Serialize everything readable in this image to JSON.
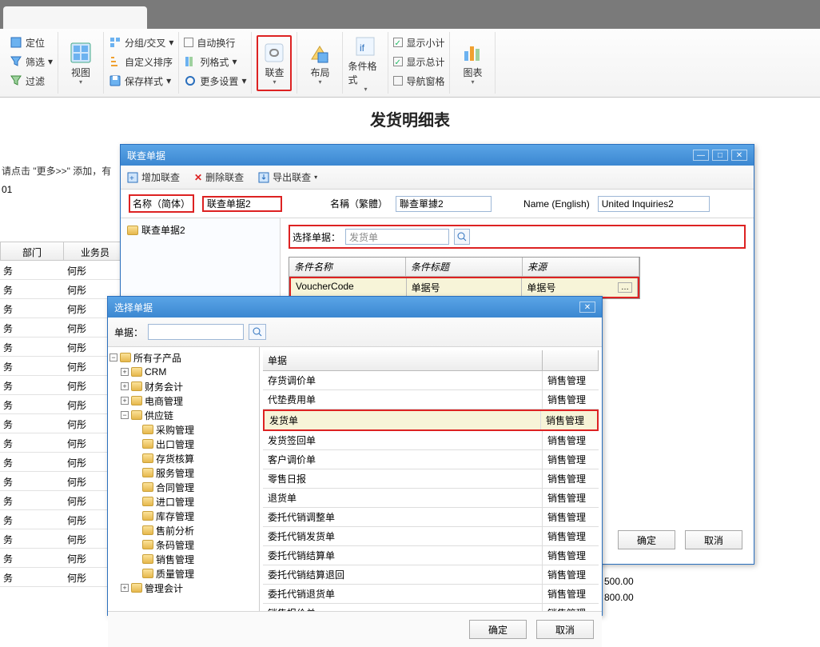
{
  "ribbon": {
    "locate": "定位",
    "filter": "筛选",
    "filter2": "过滤",
    "view": "视图",
    "group_cross": "分组/交叉",
    "custom_sort": "自定义排序",
    "save_style": "保存样式",
    "auto_wrap": "自动换行",
    "col_format": "列格式",
    "more_settings": "更多设置",
    "lianchap": "联查",
    "layout": "布局",
    "cond_format": "条件格式",
    "show_subtotal": "显示小计",
    "show_total": "显示总计",
    "nav_pane": "导航窗格",
    "chart": "图表"
  },
  "page_title": "发货明细表",
  "bg": {
    "hint": "请点击 \"更多>>\" 添加，有",
    "code": "01",
    "col1": "部门",
    "col2": "业务员",
    "v1": "务",
    "v2": "何彤"
  },
  "dialog1": {
    "title": "联查单据",
    "btn_add": "增加联查",
    "btn_del": "删除联查",
    "btn_export": "导出联查",
    "name_cn_lbl": "名称（简体）",
    "name_cn_val": "联查单据2",
    "name_tw_lbl": "名稱（繁體）",
    "name_tw_val": "聯查單據2",
    "name_en_lbl": "Name (English)",
    "name_en_val": "United Inquiries2",
    "tree_root": "联查单据2",
    "select_doc_lbl": "选择单据：",
    "select_doc_val": "发货单",
    "cond_h1": "条件名称",
    "cond_h2": "条件标题",
    "cond_h3": "来源",
    "cond_v1": "VoucherCode",
    "cond_v2": "单据号",
    "cond_v3": "单据号",
    "ok": "确定",
    "cancel": "取消"
  },
  "dialog2": {
    "title": "选择单据",
    "search_lbl": "单据：",
    "tree": {
      "root": "所有子产品",
      "n1": "CRM",
      "n2": "财务会计",
      "n3": "电商管理",
      "n4": "供应链",
      "s1": "采购管理",
      "s2": "出口管理",
      "s3": "存货核算",
      "s4": "服务管理",
      "s5": "合同管理",
      "s6": "进口管理",
      "s7": "库存管理",
      "s8": "售前分析",
      "s9": "条码管理",
      "s10": "销售管理",
      "s11": "质量管理",
      "n5": "管理会计"
    },
    "list_h1": "单据",
    "list_h2": "",
    "rows": [
      {
        "a": "存货调价单",
        "b": "销售管理"
      },
      {
        "a": "代垫费用单",
        "b": "销售管理"
      },
      {
        "a": "发货单",
        "b": "销售管理"
      },
      {
        "a": "发货签回单",
        "b": "销售管理"
      },
      {
        "a": "客户调价单",
        "b": "销售管理"
      },
      {
        "a": "零售日报",
        "b": "销售管理"
      },
      {
        "a": "退货单",
        "b": "销售管理"
      },
      {
        "a": "委托代销调整单",
        "b": "销售管理"
      },
      {
        "a": "委托代销发货单",
        "b": "销售管理"
      },
      {
        "a": "委托代销结算单",
        "b": "销售管理"
      },
      {
        "a": "委托代销结算退回",
        "b": "销售管理"
      },
      {
        "a": "委托代销退货单",
        "b": "销售管理"
      },
      {
        "a": "销售报价单",
        "b": "销售管理"
      }
    ],
    "ok": "确定",
    "cancel": "取消"
  },
  "amounts": {
    "a1": "500.00",
    "a2": "800.00"
  }
}
